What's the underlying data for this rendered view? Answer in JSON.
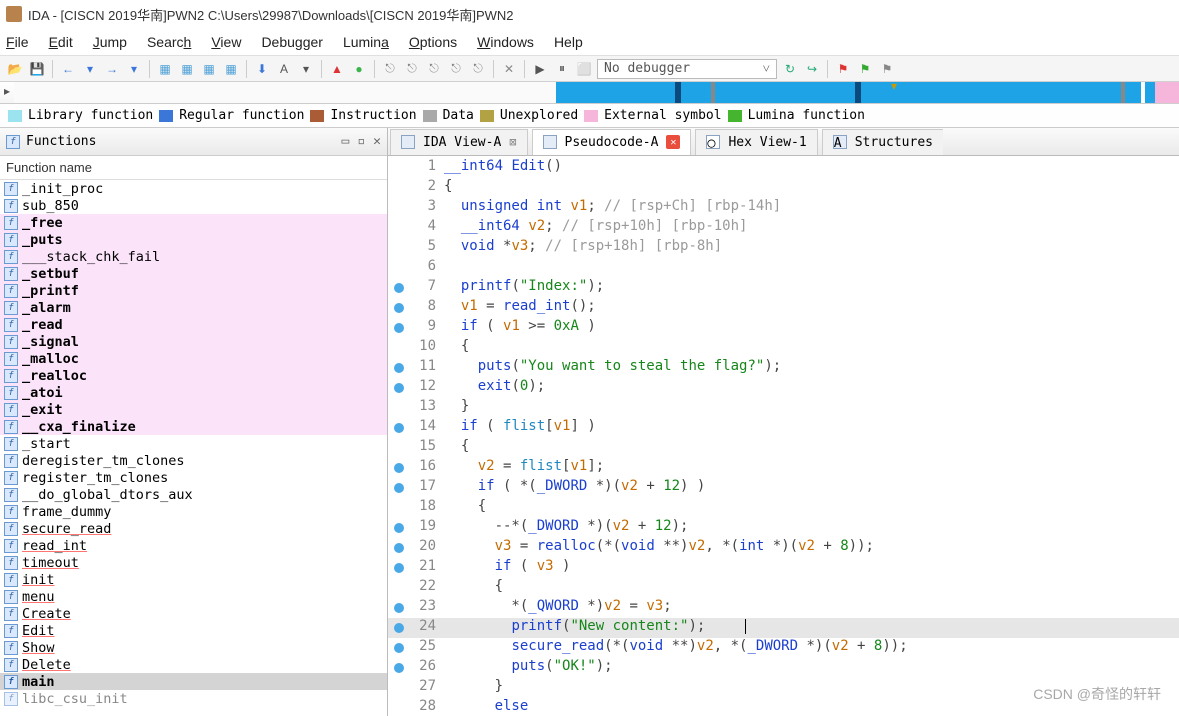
{
  "title": "IDA - [CISCN 2019华南]PWN2 C:\\Users\\29987\\Downloads\\[CISCN 2019华南]PWN2",
  "menu": {
    "file": "File",
    "edit": "Edit",
    "jump": "Jump",
    "search": "Search",
    "view": "View",
    "debugger": "Debugger",
    "lumina": "Lumina",
    "options": "Options",
    "windows": "Windows",
    "help": "Help"
  },
  "toolbar": {
    "debugger_label": "No debugger"
  },
  "legend": {
    "items": [
      {
        "color": "#9be3ef",
        "label": "Library function"
      },
      {
        "color": "#3a77d9",
        "label": "Regular function"
      },
      {
        "color": "#a95c35",
        "label": "Instruction"
      },
      {
        "color": "#a9a9a9",
        "label": "Data"
      },
      {
        "color": "#b3a244",
        "label": "Unexplored"
      },
      {
        "color": "#f6b5da",
        "label": "External symbol"
      },
      {
        "color": "#45b52f",
        "label": "Lumina function"
      }
    ]
  },
  "functions_panel": {
    "title": "Functions",
    "column": "Function name"
  },
  "functions": [
    {
      "name": "_init_proc",
      "hl": false
    },
    {
      "name": "sub_850",
      "hl": false
    },
    {
      "name": "_free",
      "hl": true,
      "bold": true
    },
    {
      "name": "_puts",
      "hl": true,
      "bold": true
    },
    {
      "name": "___stack_chk_fail",
      "hl": true
    },
    {
      "name": "_setbuf",
      "hl": true,
      "bold": true
    },
    {
      "name": "_printf",
      "hl": true,
      "bold": true
    },
    {
      "name": "_alarm",
      "hl": true,
      "bold": true
    },
    {
      "name": "_read",
      "hl": true,
      "bold": true
    },
    {
      "name": "_signal",
      "hl": true,
      "bold": true
    },
    {
      "name": "_malloc",
      "hl": true,
      "bold": true
    },
    {
      "name": "_realloc",
      "hl": true,
      "bold": true
    },
    {
      "name": "_atoi",
      "hl": true,
      "bold": true
    },
    {
      "name": "_exit",
      "hl": true,
      "bold": true
    },
    {
      "name": "__cxa_finalize",
      "hl": true,
      "bold": true
    },
    {
      "name": "_start",
      "hl": false
    },
    {
      "name": "deregister_tm_clones",
      "hl": false
    },
    {
      "name": "register_tm_clones",
      "hl": false
    },
    {
      "name": "__do_global_dtors_aux",
      "hl": false
    },
    {
      "name": "frame_dummy",
      "hl": false
    },
    {
      "name": "secure_read",
      "hl": false,
      "un": true
    },
    {
      "name": "read_int",
      "hl": false,
      "un": true
    },
    {
      "name": "timeout",
      "hl": false,
      "un": true
    },
    {
      "name": "init",
      "hl": false,
      "un": true
    },
    {
      "name": "menu",
      "hl": false,
      "un": true
    },
    {
      "name": "Create",
      "hl": false,
      "un": true
    },
    {
      "name": "Edit",
      "hl": false,
      "un": true
    },
    {
      "name": "Show",
      "hl": false,
      "un": true
    },
    {
      "name": "Delete",
      "hl": false,
      "un": true
    },
    {
      "name": "main",
      "hl": false,
      "sel": true,
      "bold": true
    },
    {
      "name": "  libc_csu_init",
      "hl": false,
      "faint": true
    }
  ],
  "tabs": {
    "ida_view": "IDA View-A",
    "pseudo": "Pseudocode-A",
    "hex": "Hex View-1",
    "struct": "Structures"
  },
  "code": [
    {
      "n": 1,
      "dot": false,
      "html": "<span class='kw'>__int64</span> <span class='fn'>Edit</span>()"
    },
    {
      "n": 2,
      "dot": false,
      "html": "{"
    },
    {
      "n": 3,
      "dot": false,
      "html": "  <span class='kw'>unsigned int</span> <span class='var'>v1</span>; <span class='cmt'>// [rsp+Ch] [rbp-14h]</span>"
    },
    {
      "n": 4,
      "dot": false,
      "html": "  <span class='kw'>__int64</span> <span class='var'>v2</span>; <span class='cmt'>// [rsp+10h] [rbp-10h]</span>"
    },
    {
      "n": 5,
      "dot": false,
      "html": "  <span class='kw'>void</span> *<span class='var'>v3</span>; <span class='cmt'>// [rsp+18h] [rbp-8h]</span>"
    },
    {
      "n": 6,
      "dot": false,
      "html": ""
    },
    {
      "n": 7,
      "dot": true,
      "html": "  <span class='fn'>printf</span>(<span class='str'>\"Index:\"</span>);"
    },
    {
      "n": 8,
      "dot": true,
      "html": "  <span class='var'>v1</span> = <span class='fn'>read_int</span>();"
    },
    {
      "n": 9,
      "dot": true,
      "html": "  <span class='kw'>if</span> ( <span class='var'>v1</span> &gt;= <span class='num'>0xA</span> )"
    },
    {
      "n": 10,
      "dot": false,
      "html": "  {"
    },
    {
      "n": 11,
      "dot": true,
      "html": "    <span class='fn'>puts</span>(<span class='str'>\"You want to steal the flag?\"</span>);"
    },
    {
      "n": 12,
      "dot": true,
      "html": "    <span class='fn'>exit</span>(<span class='num'>0</span>);"
    },
    {
      "n": 13,
      "dot": false,
      "html": "  }"
    },
    {
      "n": 14,
      "dot": true,
      "html": "  <span class='kw'>if</span> ( <span class='id'>flist</span>[<span class='var'>v1</span>] )"
    },
    {
      "n": 15,
      "dot": false,
      "html": "  {"
    },
    {
      "n": 16,
      "dot": true,
      "html": "    <span class='var'>v2</span> = <span class='id'>flist</span>[<span class='var'>v1</span>];"
    },
    {
      "n": 17,
      "dot": true,
      "html": "    <span class='kw'>if</span> ( *(<span class='kw'>_DWORD</span> *)(<span class='var'>v2</span> + <span class='num'>12</span>) )"
    },
    {
      "n": 18,
      "dot": false,
      "html": "    {"
    },
    {
      "n": 19,
      "dot": true,
      "html": "      --*(<span class='kw'>_DWORD</span> *)(<span class='var'>v2</span> + <span class='num'>12</span>);"
    },
    {
      "n": 20,
      "dot": true,
      "html": "      <span class='var'>v3</span> = <span class='fn'>realloc</span>(*(<span class='kw'>void</span> **)<span class='var'>v2</span>, *(<span class='kw'>int</span> *)(<span class='var'>v2</span> + <span class='num'>8</span>));"
    },
    {
      "n": 21,
      "dot": true,
      "html": "      <span class='kw'>if</span> ( <span class='var'>v3</span> )"
    },
    {
      "n": 22,
      "dot": false,
      "html": "      {"
    },
    {
      "n": 23,
      "dot": true,
      "html": "        *(<span class='kw'>_QWORD</span> *)<span class='var'>v2</span> = <span class='var'>v3</span>;"
    },
    {
      "n": 24,
      "dot": true,
      "cur": true,
      "html": "        <span class='fn'>printf</span>(<span class='str'>\"New content:\"</span>);<span class='cursor'></span>"
    },
    {
      "n": 25,
      "dot": true,
      "html": "        <span class='fn'>secure_read</span>(*(<span class='kw'>void</span> **)<span class='var'>v2</span>, *(<span class='kw'>_DWORD</span> *)(<span class='var'>v2</span> + <span class='num'>8</span>));"
    },
    {
      "n": 26,
      "dot": true,
      "html": "        <span class='fn'>puts</span>(<span class='str'>\"OK!\"</span>);"
    },
    {
      "n": 27,
      "dot": false,
      "html": "      }"
    },
    {
      "n": 28,
      "dot": false,
      "html": "      <span class='kw'>else</span>"
    }
  ],
  "watermark": "CSDN @奇怪的轩轩"
}
